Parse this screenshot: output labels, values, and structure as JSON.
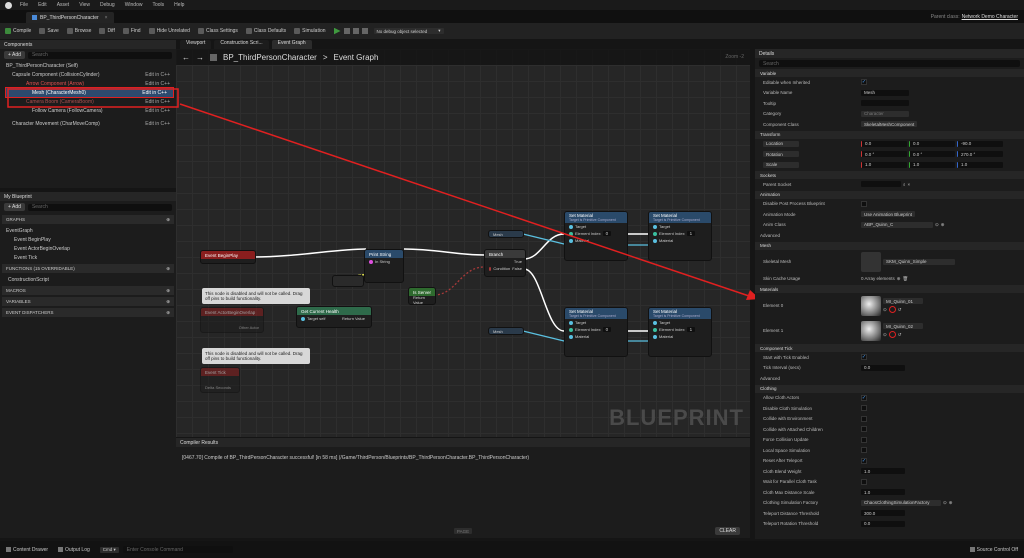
{
  "menu": [
    "File",
    "Edit",
    "Asset",
    "View",
    "Debug",
    "Window",
    "Tools",
    "Help"
  ],
  "tab_title": "BP_ThirdPersonCharacter",
  "parent_class_label": "Parent class:",
  "parent_class_value": "Network Demo Character",
  "toolbar": {
    "compile": "Compile",
    "save": "Save",
    "browse": "Browse",
    "diff": "Diff",
    "find": "Find",
    "hide_unrelated": "Hide Unrelated",
    "class_settings": "Class Settings",
    "class_defaults": "Class Defaults",
    "simulation": "Simulation",
    "debug_object": "No debug object selected"
  },
  "components": {
    "title": "Components",
    "add": "+ Add",
    "search": "Search",
    "items": [
      {
        "label": "BP_ThirdPersonCharacter (Self)",
        "edit": ""
      },
      {
        "label": "Capsule Component (CollisionCylinder)",
        "edit": "Edit in C++"
      },
      {
        "label": "Arrow Component (Arrow)",
        "edit": "Edit in C++"
      },
      {
        "label": "Mesh (CharacterMesh0)",
        "edit": "Edit in C++"
      },
      {
        "label": "Camera Boom (CameraBoom)",
        "edit": "Edit in C++"
      },
      {
        "label": "Follow Camera (FollowCamera)",
        "edit": "Edit in C++"
      },
      {
        "label": "Character Movement (CharMoveComp)",
        "edit": "Edit in C++"
      }
    ]
  },
  "myblueprint": {
    "title": "My Blueprint",
    "add": "+ Add",
    "search": "Search",
    "graphs": "GRAPHS",
    "event_graph": "EventGraph",
    "events": [
      "Event BeginPlay",
      "Event ActorBeginOverlap",
      "Event Tick"
    ],
    "functions": "FUNCTIONS (15 OVERRIDABLE)",
    "construction": "ConstructionScript",
    "macros": "MACROS",
    "variables": "VARIABLES",
    "dispatchers": "EVENT DISPATCHERS"
  },
  "graph_tabs": [
    "Viewport",
    "Construction Scri...",
    "Event Graph"
  ],
  "breadcrumb": {
    "root": "BP_ThirdPersonCharacter",
    "sep": ">",
    "leaf": "Event Graph"
  },
  "zoom": "Zoom -2",
  "watermark": "BLUEPRINT",
  "nodes": {
    "begin_play": "Event BeginPlay",
    "print_string": "Print String",
    "in_string": "In String",
    "branch": "Branch",
    "condition": "Condition",
    "true": "True",
    "false": "False",
    "is_server": "Is Server",
    "return_value": "Return Value",
    "get_health": "Get Current Health",
    "target_self": "Target self",
    "set_material": "Set Material",
    "set_material_sub": "Target is Primitive Component",
    "target": "Target",
    "element_index": "Element Index",
    "element_index_val": "0",
    "element_index_val2": "1",
    "material": "Material",
    "material_val": "MI_Quinn_01",
    "mesh": "Mesh",
    "note": "This node is disabled and will not be called. Drag off pins to build functionality.",
    "event_overlap": "Event ActorBeginOverlap",
    "other_actor": "Other Actor",
    "event_tick": "Event Tick",
    "delta_seconds": "Delta Seconds"
  },
  "compiler": {
    "title": "Compiler Results",
    "message": "[0467.70] Compile of BP_ThirdPersonCharacter successful! [in 58 ms] (/Game/ThirdPerson/Blueprints/BP_ThirdPersonCharacter.BP_ThirdPersonCharacter)",
    "page": "PAGE",
    "clear": "CLEAR"
  },
  "details": {
    "title": "Details",
    "search": "Search",
    "variable": "Variable",
    "editable": "Editable when Inherited",
    "var_name_l": "Variable Name",
    "var_name": "Mesh",
    "tooltip": "Tooltip",
    "category_l": "Category",
    "category": "Character",
    "comp_class_l": "Component Class",
    "comp_class": "SkeletalMeshComponent",
    "transform": "Transform",
    "location": "Location",
    "rotation": "Rotation",
    "scale": "Scale",
    "loc": [
      "0.0",
      "0.0",
      "-90.0"
    ],
    "rot": [
      "0.0 °",
      "0.0 °",
      "270.0 °"
    ],
    "scl": [
      "1.0",
      "1.0",
      "1.0"
    ],
    "sockets": "Sockets",
    "parent_socket": "Parent Socket",
    "animation": "Animation",
    "disable_pp": "Disable Post Process Blueprint",
    "anim_mode_l": "Animation Mode",
    "anim_mode": "Use Animation Blueprint",
    "anim_class_l": "Anim Class",
    "anim_class": "ABP_Quinn_C",
    "advanced": "Advanced",
    "mesh": "Mesh",
    "skeletal_mesh": "Skeletal Mesh",
    "skeletal_mesh_val": "SKM_Quinn_Simple",
    "skin_cache": "Skin Cache Usage",
    "skin_cache_val": "0 Array elements",
    "materials": "Materials",
    "element0": "Element 0",
    "element1": "Element 1",
    "mat0": "MI_Quinn_01",
    "mat1": "MI_Quinn_02",
    "component_tick": "Component Tick",
    "start_tick": "Start with Tick Enabled",
    "tick_interval": "Tick Interval (secs)",
    "tick_interval_val": "0.0",
    "clothing": "Clothing",
    "cloth_items": [
      "Allow Cloth Actors",
      "Disable Cloth Simulation",
      "Collide with Environment",
      "Collide with Attached Children",
      "Force Collision Update",
      "Local Space Simulation",
      "Reset After Teleport",
      "Cloth Blend Weight",
      "Wait for Parallel Cloth Task",
      "Cloth Max Distance Scale",
      "Clothing Simulation Factory",
      "Teleport Distance Threshold",
      "Teleport Rotation Threshold"
    ],
    "cloth_blend": "1.0",
    "cloth_max": "1.0",
    "cloth_factory": "ChaosClothingSimulationFactory",
    "tele_dist": "300.0",
    "tele_rot": "0.0"
  },
  "status": {
    "content_drawer": "Content Drawer",
    "output_log": "Output Log",
    "cmd": "Cmd",
    "console": "Enter Console Command",
    "source_control": "Source Control Off"
  }
}
